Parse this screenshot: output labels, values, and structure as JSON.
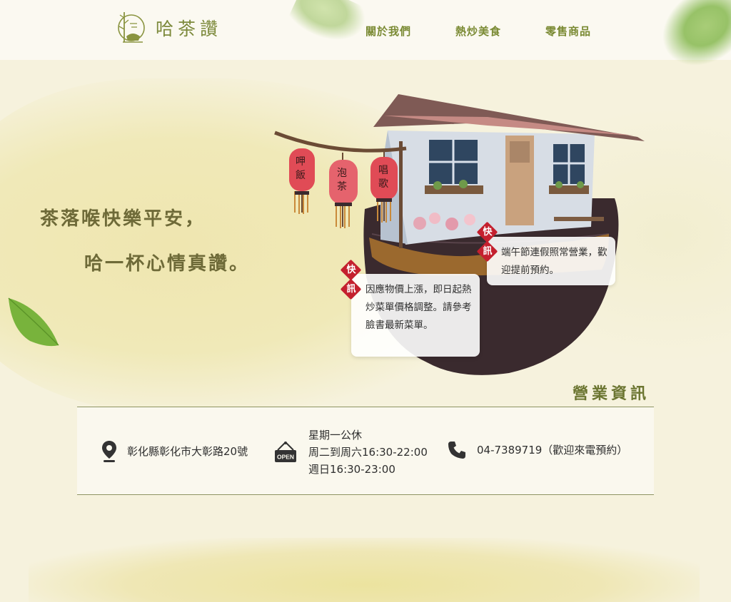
{
  "brand": {
    "name": "哈茶讚"
  },
  "nav": [
    {
      "label": "關於我們"
    },
    {
      "label": "熱炒美食"
    },
    {
      "label": "零售商品"
    }
  ],
  "hero": {
    "line1": "茶落喉快樂平安，",
    "line2": "哈一杯心情真讚。"
  },
  "lanterns": [
    "呷飯",
    "泡茶",
    "唱歌"
  ],
  "notices": {
    "badge": [
      "快",
      "訊"
    ],
    "notice1": "端午節連假照常營業，歡迎提前預約。",
    "notice2": "因應物價上漲，即日起熱炒菜單價格調整。請參考臉書最新菜單。"
  },
  "info": {
    "title": "營業資訊",
    "address": "彰化縣彰化市大彰路20號",
    "open_sign": "OPEN",
    "hours": [
      "星期一公休",
      "周二到周六16:30-22:00",
      "週日16:30-23:00"
    ],
    "phone": "04-7389719（歡迎來電預約）"
  },
  "colors": {
    "accent": "#7a8a33",
    "badge_red": "#c4202e",
    "background": "#f6f2dd"
  }
}
